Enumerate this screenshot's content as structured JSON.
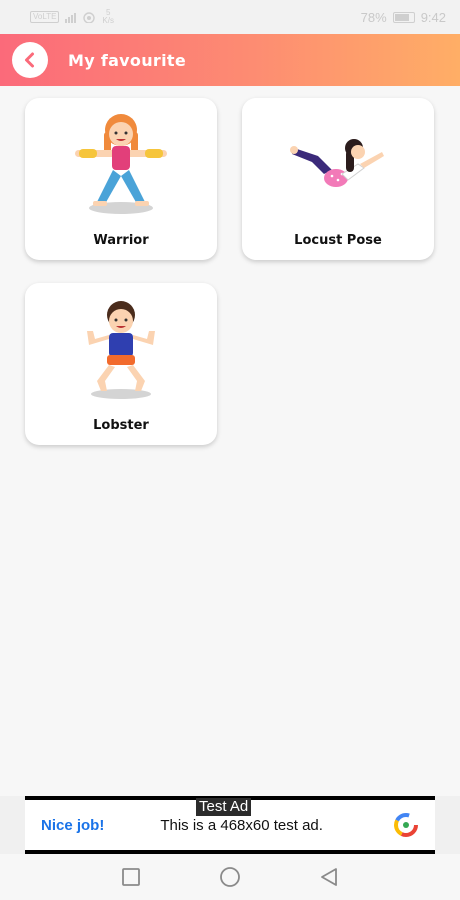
{
  "status_bar": {
    "carrier_badge": "VoLTE",
    "speed_value": "5",
    "speed_unit": "K/s",
    "battery": "78%",
    "time": "9:42"
  },
  "header": {
    "title": "My favourite",
    "back_icon": "chevron-left-icon",
    "gradient": [
      "#fb6a7a",
      "#ffae66"
    ]
  },
  "favourites": [
    {
      "label": "Warrior",
      "icon": "warrior-pose-illustration"
    },
    {
      "label": "Locust Pose",
      "icon": "locust-pose-illustration"
    },
    {
      "label": "Lobster",
      "icon": "lobster-pose-illustration"
    }
  ],
  "ad": {
    "tag": "Test Ad",
    "cta": "Nice job!",
    "text": "This is a 468x60 test ad.",
    "logo_icon": "ads-logo-icon"
  },
  "nav_bar": {
    "recent_icon": "square-icon",
    "home_icon": "circle-icon",
    "back_icon": "triangle-back-icon"
  }
}
